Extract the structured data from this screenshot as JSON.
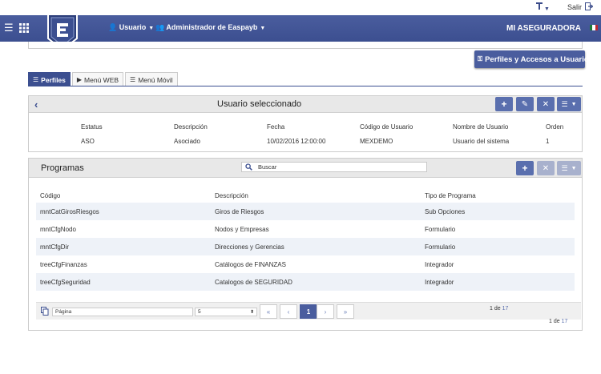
{
  "topbar": {
    "salir_label": "Salir"
  },
  "nav": {
    "usuario_label": "Usuario",
    "admin_label": "Administrador de Easpayb",
    "brand": "MI ASEGURADORA"
  },
  "actions": {
    "perfiles_accesos_label": "Perfiles y Accesos a Usuarios"
  },
  "tabs": [
    {
      "label": "Perfiles",
      "active": true
    },
    {
      "label": "Menú WEB",
      "active": false
    },
    {
      "label": "Menú Móvil",
      "active": false
    }
  ],
  "usuario_panel": {
    "title": "Usuario seleccionado",
    "headers": [
      "Estatus",
      "Descripción",
      "Fecha",
      "Código de Usuario",
      "Nombre de Usuario",
      "Orden"
    ],
    "values": [
      "ASO",
      "Asociado",
      "10/02/2016 12:00:00",
      "MEXDEMO",
      "Usuario del sistema",
      "1"
    ]
  },
  "programas_panel": {
    "title": "Programas",
    "search_placeholder": "Buscar",
    "headers": [
      "Código",
      "Descripción",
      "Tipo de Programa"
    ],
    "rows": [
      [
        "mntCatGirosRiesgos",
        "Giros de Riesgos",
        "Sub Opciones"
      ],
      [
        "mntCfgNodo",
        "Nodos y Empresas",
        "Formulario"
      ],
      [
        "mntCfgDir",
        "Direcciones y Gerencias",
        "Formulario"
      ],
      [
        "treeCfgFinanzas",
        "Catálogos de FINANZAS",
        "Integrador"
      ],
      [
        "treeCfgSeguridad",
        "Catalogos de SEGURIDAD",
        "Integrador"
      ]
    ]
  },
  "pagination": {
    "page_label": "Página",
    "page_size": "5",
    "first": "«",
    "prev": "‹",
    "current": "1",
    "next": "›",
    "last": "»",
    "page_num": "1",
    "de": "de",
    "total": "17"
  },
  "colors": {
    "primary": "#3c4f90",
    "button": "#5a6fae",
    "button_disabled": "#a8b1cd",
    "row_alt": "#eef2f8"
  }
}
